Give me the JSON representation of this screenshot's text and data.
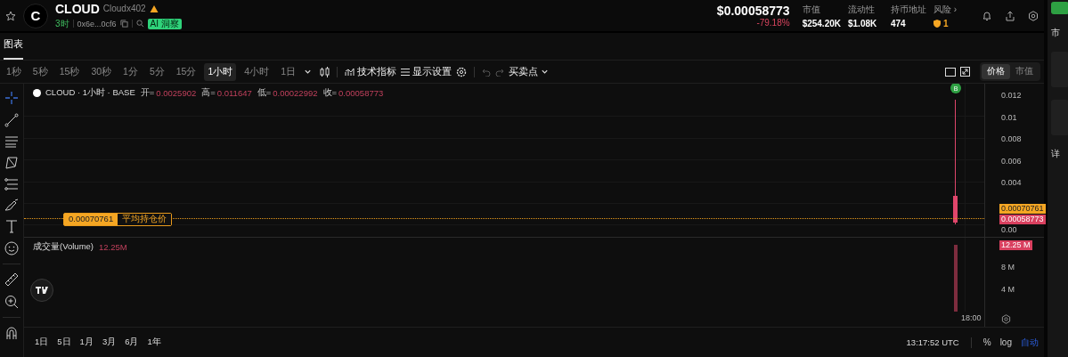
{
  "header": {
    "symbol": "CLOUD",
    "avatar_letter": "C",
    "name": "Cloudx402",
    "age": "3时",
    "address": "0x6e...0cf6",
    "ai_badge": "AI 洞察",
    "price": "$0.00058773",
    "change": "-79.18%",
    "stats": [
      {
        "label": "市值",
        "value": "$254.20K"
      },
      {
        "label": "流动性",
        "value": "$1.08K"
      },
      {
        "label": "持币地址",
        "value": "474"
      },
      {
        "label": "风险 ›",
        "value": "1",
        "kind": "risk"
      }
    ]
  },
  "tabs": [
    {
      "label": "图表",
      "selected": true
    }
  ],
  "intervals": [
    {
      "label": "1秒",
      "selected": false
    },
    {
      "label": "5秒",
      "selected": false
    },
    {
      "label": "15秒",
      "selected": false
    },
    {
      "label": "30秒",
      "selected": false
    },
    {
      "label": "1分",
      "selected": false
    },
    {
      "label": "5分",
      "selected": false
    },
    {
      "label": "15分",
      "selected": false
    },
    {
      "label": "1小时",
      "selected": true
    },
    {
      "label": "4小时",
      "selected": false
    },
    {
      "label": "1日",
      "selected": false
    }
  ],
  "toolbar": {
    "indicators": "技术指标",
    "display": "显示设置",
    "trade_marks": "买卖点"
  },
  "view_toggle": [
    {
      "label": "价格",
      "selected": true
    },
    {
      "label": "市值",
      "selected": false
    }
  ],
  "legend": {
    "title": "CLOUD · 1小时 · BASE",
    "ohlc": [
      {
        "label": "开=",
        "value": "0.0025902"
      },
      {
        "label": "高=",
        "value": "0.011647"
      },
      {
        "label": "低=",
        "value": "0.00022992"
      },
      {
        "label": "收=",
        "value": "0.00058773"
      }
    ]
  },
  "buy_marker": "B",
  "avg_line": {
    "value": "0.00070761",
    "label": "平均持仓价"
  },
  "price_axis": [
    "0.012",
    "0.01",
    "0.008",
    "0.006",
    "0.004"
  ],
  "price_axis_zero": "0.00",
  "price_tags": {
    "average": "0.00070761",
    "current": "0.00058773"
  },
  "volume": {
    "title": "成交量(Volume)",
    "value": "12.25M",
    "tag": "12.25 M",
    "axis": [
      "8 M",
      "4 M"
    ]
  },
  "time_label": "18:00",
  "ranges": [
    "1日",
    "5日",
    "1月",
    "3月",
    "6月",
    "1年"
  ],
  "clock": "13:17:52 UTC",
  "scale_options": [
    {
      "label": "%",
      "selected": false
    },
    {
      "label": "log",
      "selected": false
    },
    {
      "label": "自动",
      "selected": true
    }
  ],
  "side_panel": {
    "top": "市",
    "bottom": "详"
  }
}
